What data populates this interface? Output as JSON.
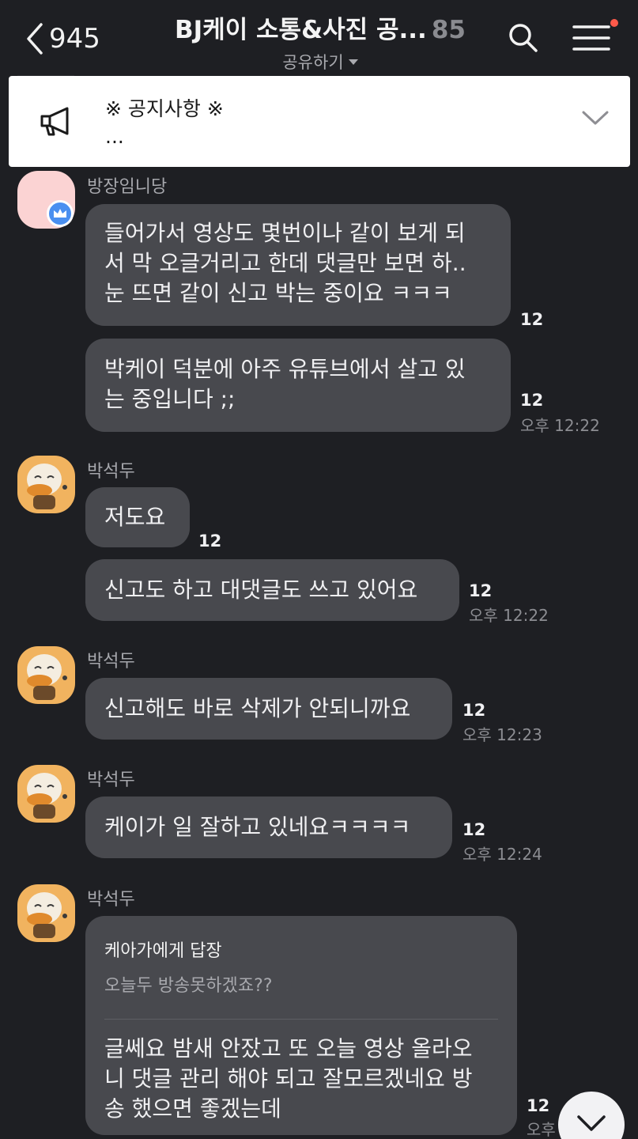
{
  "header": {
    "back_count": "945",
    "title": "BJ케이 소통&사진 공...",
    "member_count": "85",
    "share_label": "공유하기"
  },
  "notice": {
    "title": "※ 공지사항 ※",
    "body": "..."
  },
  "messages": [
    {
      "sender": "방장임니당",
      "bubbles": [
        {
          "text": "들어가서 영상도 몇번이나 같이 보게 되\n서 막 오글거리고 한데 댓글만 보면 하..\n눈 뜨면 같이 신고 박는 중이요 ㅋㅋㅋ",
          "unread": "12",
          "time": ""
        },
        {
          "text": "박케이 덕분에 아주 유튜브에서 살고 있\n는 중입니다 ;;",
          "unread": "12",
          "time": "오후 12:22"
        }
      ]
    },
    {
      "sender": "박석두",
      "bubbles": [
        {
          "text": "저도요",
          "unread": "12",
          "time": ""
        },
        {
          "text": "신고도 하고 대댓글도 쓰고 있어요",
          "unread": "12",
          "time": "오후 12:22"
        }
      ]
    },
    {
      "sender": "박석두",
      "bubbles": [
        {
          "text": "신고해도 바로 삭제가 안되니까요",
          "unread": "12",
          "time": "오후 12:23"
        }
      ]
    },
    {
      "sender": "박석두",
      "bubbles": [
        {
          "text": "케이가 일 잘하고 있네요ㅋㅋㅋㅋ",
          "unread": "12",
          "time": "오후 12:24"
        }
      ]
    },
    {
      "sender": "박석두",
      "reply": {
        "to": "케아가에게 답장",
        "quote": "오늘두 방송못하겠죠??"
      },
      "bubbles": [
        {
          "text": "글쎄요 밤새 안잤고 또 오늘 영상 올라오\n니 댓글 관리 해야 되고 잘모르겠네요 방\n송 했으면 좋겠는데",
          "unread": "12",
          "time": "오후"
        }
      ]
    }
  ],
  "colors": {
    "background": "#1e1f23",
    "bubble": "#48494e",
    "notice_bg": "#ffffff",
    "badge_dot": "#ff5a4a",
    "crown_badge": "#4a8ff0"
  },
  "icons": [
    "back-chevron-icon",
    "search-icon",
    "menu-icon",
    "megaphone-icon",
    "chevron-down-icon",
    "crown-icon",
    "duck-avatar-icon"
  ]
}
